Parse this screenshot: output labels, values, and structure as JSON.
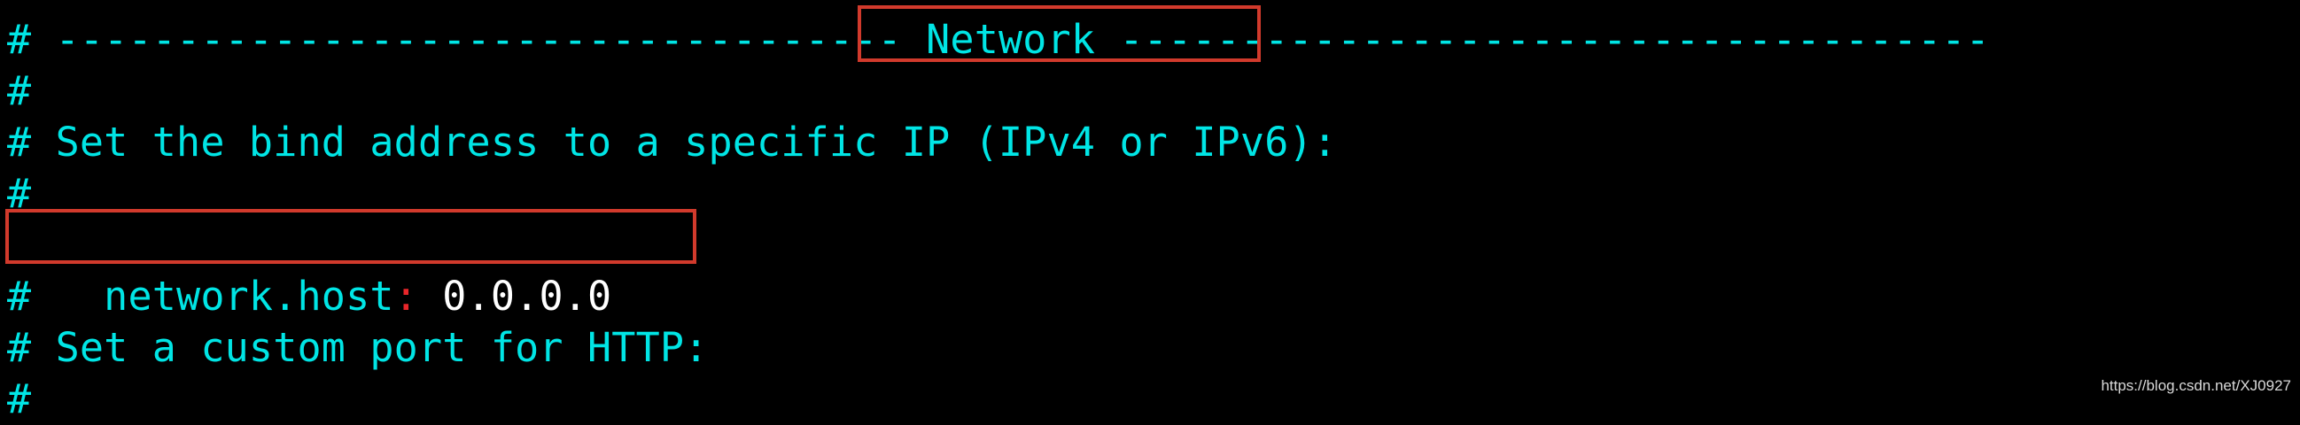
{
  "terminal": {
    "lines": [
      "# ----------------------------------- Network ------------------------------------",
      "#",
      "# Set the bind address to a specific IP (IPv4 or IPv6):",
      "#"
    ],
    "setting": {
      "key": "network.host",
      "colon": ":",
      "value": " 0.0.0.0"
    },
    "lines_after": [
      "#",
      "# Set a custom port for HTTP:",
      "#"
    ]
  },
  "watermark": "https://blog.csdn.net/XJ0927",
  "colors": {
    "comment": "#00e5e5",
    "colon": "#e8262a",
    "value": "#ffffff",
    "highlight": "#d13a2c",
    "background": "#000000"
  }
}
